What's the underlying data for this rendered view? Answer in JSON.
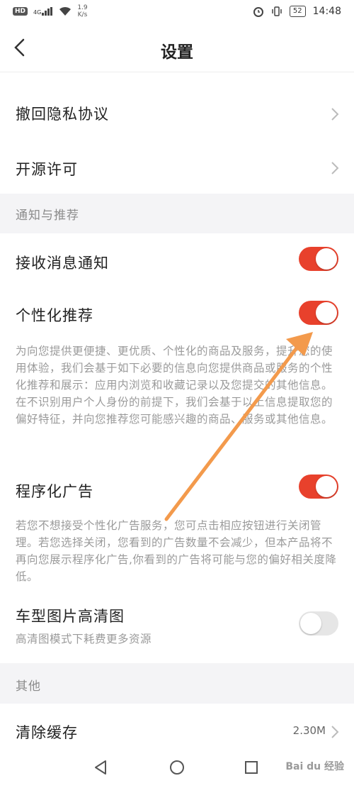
{
  "status_bar": {
    "hd": "HD",
    "signal": "4G",
    "speed_value": "1.9",
    "speed_unit": "K/s",
    "battery": "52",
    "time": "14:48"
  },
  "header": {
    "title": "设置"
  },
  "items": {
    "privacy": "撤回隐私协议",
    "license": "开源许可"
  },
  "sections": {
    "notify": "通知与推荐",
    "other": "其他"
  },
  "toggles": {
    "receive": {
      "label": "接收消息通知",
      "on": true
    },
    "personal": {
      "label": "个性化推荐",
      "on": true,
      "desc": "为向您提供更便捷、更优质、个性化的商品及服务，提升您的使用体验，我们会基于如下必要的信息向您提供商品或服务的个性化推荐和展示：应用内浏览和收藏记录以及您提交的其他信息。在不识别用户个人身份的前提下，我们会基于以上信息提取您的偏好特征，并向您推荐您可能感兴趣的商品、服务或其他信息。"
    },
    "ads": {
      "label": "程序化广告",
      "on": true,
      "desc": "若您不想接受个性化广告服务，您可点击相应按钮进行关闭管理。若您选择关闭，您看到的广告数量不会减少，但本产品将不再向您展示程序化广告,你看到的广告将可能与您的偏好相关度降低。"
    },
    "hd_image": {
      "label": "车型图片高清图",
      "on": false,
      "desc": "高清图模式下耗费更多资源"
    }
  },
  "cache": {
    "label": "清除缓存",
    "value": "2.30M"
  },
  "watermark": "Bai du 经验",
  "colors": {
    "accent": "#e8412c",
    "arrow": "#f39a4c",
    "section_bg": "#f4f4f6"
  }
}
